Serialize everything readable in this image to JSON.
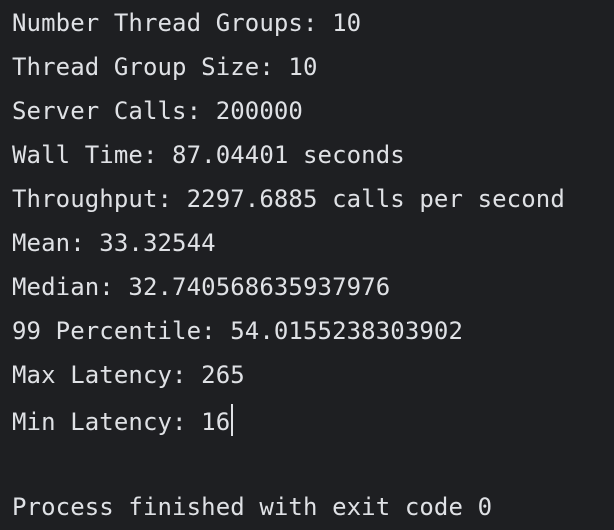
{
  "console": {
    "lines": [
      "Number Thread Groups: 10",
      "Thread Group Size: 10",
      "Server Calls: 200000",
      "Wall Time: 87.04401 seconds",
      "Throughput: 2297.6885 calls per second",
      "Mean: 33.32544",
      "Median: 32.740568635937976",
      "99 Percentile: 54.0155238303902",
      "Max Latency: 265",
      "Min Latency: 16"
    ],
    "exit_message": "Process finished with exit code 0"
  }
}
